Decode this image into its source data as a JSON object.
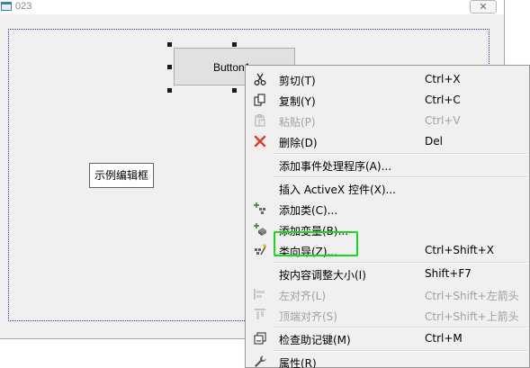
{
  "window": {
    "title": "023",
    "close_glyph": "✕"
  },
  "controls": {
    "button_label": "Button1",
    "static_label": "示例编辑框"
  },
  "menu": {
    "items": [
      {
        "label": "剪切(T)",
        "shortcut": "Ctrl+X",
        "icon": "scissors-icon",
        "enabled": true
      },
      {
        "label": "复制(Y)",
        "shortcut": "Ctrl+C",
        "icon": "copy-icon",
        "enabled": true
      },
      {
        "label": "粘贴(P)",
        "shortcut": "Ctrl+V",
        "icon": "paste-icon",
        "enabled": false
      },
      {
        "label": "删除(D)",
        "shortcut": "Del",
        "icon": "delete-icon",
        "enabled": true
      },
      {
        "label": "添加事件处理程序(A)...",
        "shortcut": "",
        "icon": "",
        "enabled": true
      },
      {
        "label": "插入 ActiveX 控件(X)...",
        "shortcut": "",
        "icon": "",
        "enabled": true
      },
      {
        "label": "添加类(C)...",
        "shortcut": "",
        "icon": "add-class-icon",
        "enabled": true
      },
      {
        "label": "添加变量(B)...",
        "shortcut": "",
        "icon": "add-variable-icon",
        "enabled": true
      },
      {
        "label": "类向导(Z)...",
        "shortcut": "Ctrl+Shift+X",
        "icon": "class-wizard-icon",
        "enabled": true
      },
      {
        "label": "按内容调整大小(I)",
        "shortcut": "Shift+F7",
        "icon": "",
        "enabled": true
      },
      {
        "label": "左对齐(L)",
        "shortcut": "Ctrl+Shift+左箭头",
        "icon": "align-left-icon",
        "enabled": false
      },
      {
        "label": "顶端对齐(S)",
        "shortcut": "Ctrl+Shift+上箭头",
        "icon": "align-top-icon",
        "enabled": false
      },
      {
        "label": "检查助记键(M)",
        "shortcut": "Ctrl+M",
        "icon": "check-mnemonics-icon",
        "enabled": true
      },
      {
        "label": "属性(R)",
        "shortcut": "",
        "icon": "wrench-icon",
        "enabled": true
      }
    ]
  },
  "colors": {
    "highlight_box": "#17d91f",
    "delete_red": "#e23b2e"
  }
}
